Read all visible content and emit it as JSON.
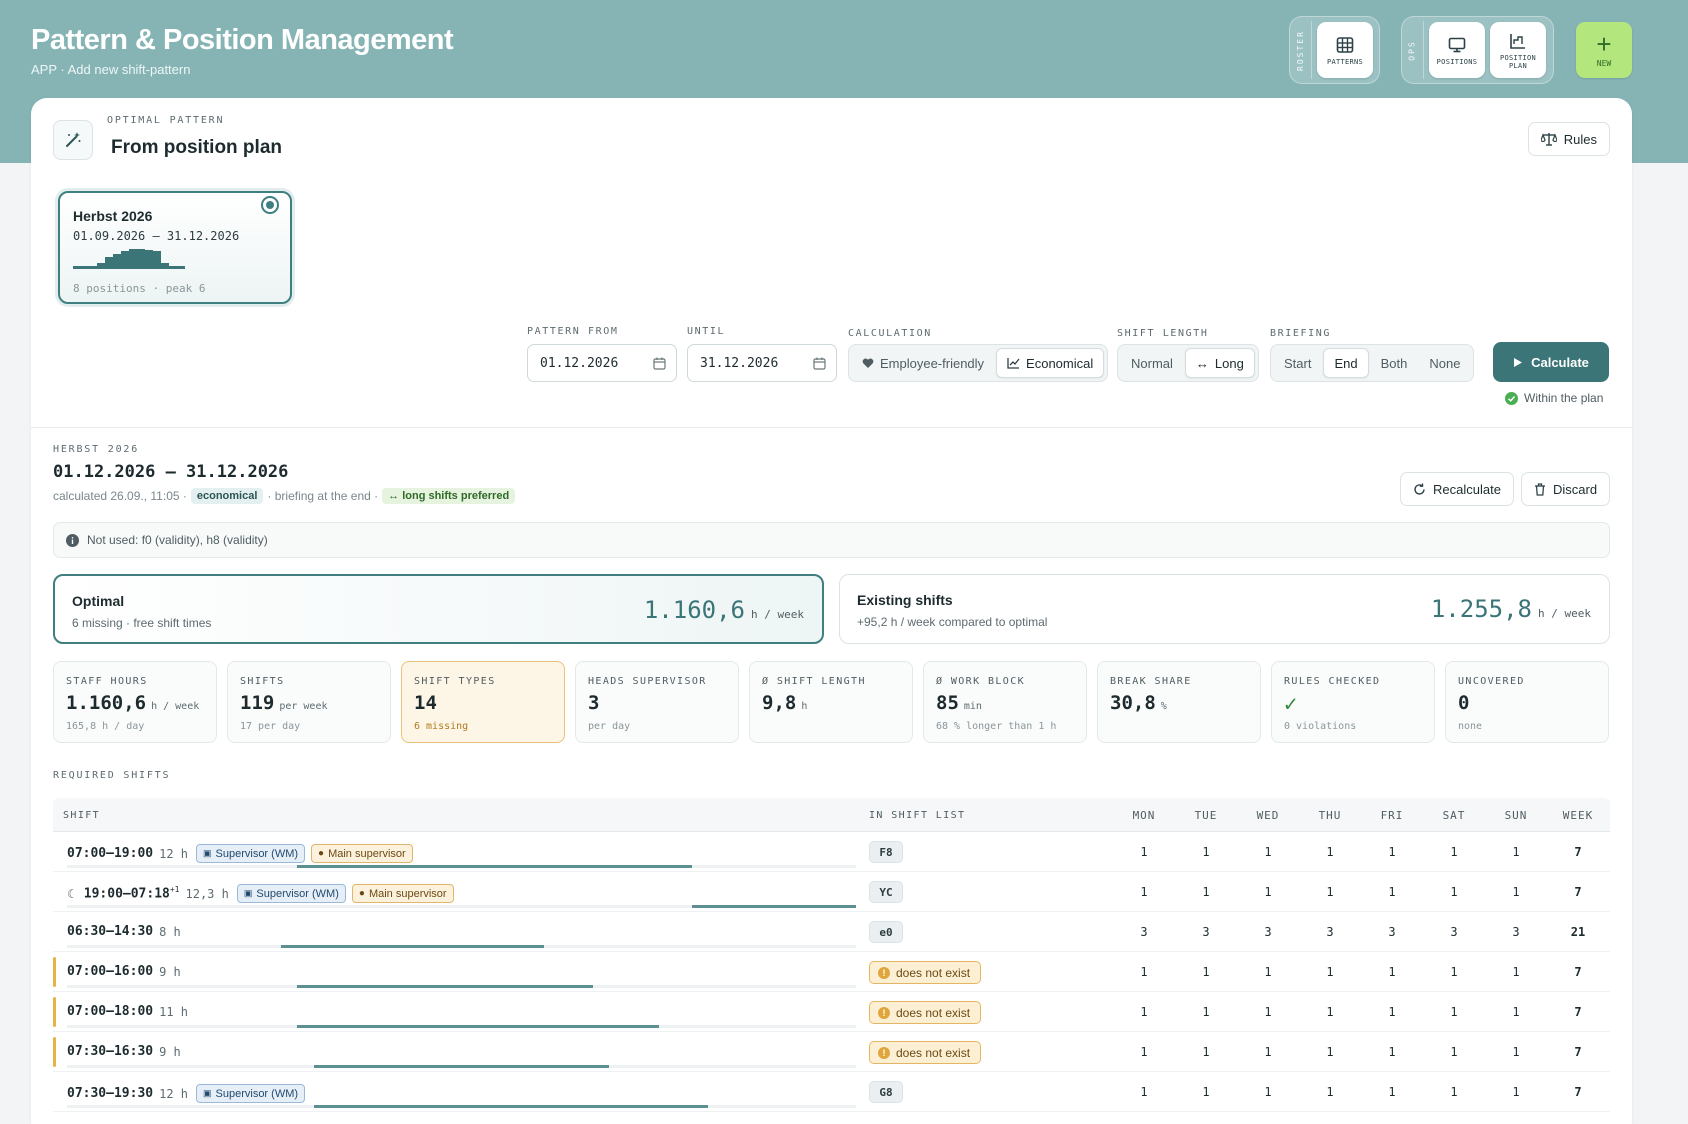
{
  "app": {
    "title": "Pattern & Position Management",
    "breadcrumb": "APP · Add new shift-pattern"
  },
  "nav": {
    "roster_label": "ROSTER",
    "ops_label": "OPS",
    "patterns": "PATTERNS",
    "positions": "POSITIONS",
    "position_plan_1": "POSITION",
    "position_plan_2": "PLAN",
    "new": "NEW"
  },
  "header": {
    "kicker": "OPTIMAL PATTERN",
    "title": "From position plan",
    "rules": "Rules"
  },
  "plan": {
    "name": "Herbst 2026",
    "range": "01.09.2026 – 31.12.2026",
    "footer": "8 positions · peak 6",
    "profile": [
      0.15,
      0.15,
      0.15,
      0.3,
      0.6,
      0.75,
      0.9,
      1.0,
      1.0,
      0.95,
      0.9,
      0.3,
      0.15,
      0.15
    ]
  },
  "form": {
    "from_label": "PATTERN FROM",
    "from_value": "01.12.2026",
    "until_label": "UNTIL",
    "until_value": "31.12.2026",
    "calc_label": "CALCULATION",
    "calc_opt1": "Employee-friendly",
    "calc_opt2": "Economical",
    "len_label": "SHIFT LENGTH",
    "len_opt1": "Normal",
    "len_opt2": "Long",
    "brief_label": "BRIEFING",
    "brief_opt1": "Start",
    "brief_opt2": "End",
    "brief_opt3": "Both",
    "brief_opt4": "None",
    "calculate": "Calculate",
    "within": "Within the plan"
  },
  "result": {
    "kicker": "HERBST 2026",
    "range": "01.12.2026 – 31.12.2026",
    "calculated": "calculated 26.09., 11:05 ·",
    "mode": "economical",
    "briefing": "· briefing at the end ·",
    "pref": "↔ long shifts preferred",
    "recalculate": "Recalculate",
    "discard": "Discard",
    "info": "Not used: f0 (validity), h8 (validity)"
  },
  "compare": {
    "optimal": {
      "title": "Optimal",
      "sub": "6 missing · free shift times",
      "value": "1.160,6",
      "unit": "h / week"
    },
    "existing": {
      "title": "Existing shifts",
      "sub": "+95,2 h / week compared to optimal",
      "value": "1.255,8",
      "unit": "h / week"
    }
  },
  "kpis": [
    {
      "label": "STAFF HOURS",
      "value": "1.160,6",
      "unit": "h / week",
      "sub": "165,8 h / day"
    },
    {
      "label": "SHIFTS",
      "value": "119",
      "unit": "per week",
      "sub": "17 per day"
    },
    {
      "label": "SHIFT TYPES",
      "value": "14",
      "unit": "",
      "sub": "6 missing"
    },
    {
      "label": "HEADS SUPERVISOR",
      "value": "3",
      "unit": "",
      "sub": "per day"
    },
    {
      "label": "Ø SHIFT LENGTH",
      "value": "9,8",
      "unit": "h",
      "sub": ""
    },
    {
      "label": "Ø WORK BLOCK",
      "value": "85",
      "unit": "min",
      "sub": "68 % longer than 1 h"
    },
    {
      "label": "BREAK SHARE",
      "value": "30,8",
      "unit": "%",
      "sub": ""
    },
    {
      "label": "RULES CHECKED",
      "value": "✓",
      "unit": "",
      "sub": "0 violations"
    },
    {
      "label": "UNCOVERED",
      "value": "0",
      "unit": "",
      "sub": "none"
    }
  ],
  "table": {
    "kicker": "REQUIRED SHIFTS",
    "col_shift": "SHIFT",
    "col_list": "IN SHIFT LIST",
    "days": [
      "MON",
      "TUE",
      "WED",
      "THU",
      "FRI",
      "SAT",
      "SUN",
      "WEEK"
    ],
    "missing_label": "does not exist",
    "tag_supervisor": "Supervisor (WM)",
    "tag_main": "Main supervisor",
    "rows": [
      {
        "time": "07:00–19:00",
        "len": "12 h",
        "code": "F8",
        "counts": [
          "1",
          "1",
          "1",
          "1",
          "1",
          "1",
          "1",
          "7"
        ],
        "start": 7,
        "end": 19
      },
      {
        "time": "19:00–07:18",
        "sup": "+1",
        "len": "12,3 h",
        "code": "YC",
        "counts": [
          "1",
          "1",
          "1",
          "1",
          "1",
          "1",
          "1",
          "7"
        ],
        "start": 19,
        "end": 24
      },
      {
        "time": "06:30–14:30",
        "len": "8 h",
        "code": "e0",
        "counts": [
          "3",
          "3",
          "3",
          "3",
          "3",
          "3",
          "3",
          "21"
        ],
        "start": 6.5,
        "end": 14.5
      },
      {
        "time": "07:00–16:00",
        "len": "9 h",
        "code": "",
        "counts": [
          "1",
          "1",
          "1",
          "1",
          "1",
          "1",
          "1",
          "7"
        ],
        "start": 7,
        "end": 16
      },
      {
        "time": "07:00–18:00",
        "len": "11 h",
        "code": "",
        "counts": [
          "1",
          "1",
          "1",
          "1",
          "1",
          "1",
          "1",
          "7"
        ],
        "start": 7,
        "end": 18
      },
      {
        "time": "07:30–16:30",
        "len": "9 h",
        "code": "",
        "counts": [
          "1",
          "1",
          "1",
          "1",
          "1",
          "1",
          "1",
          "7"
        ],
        "start": 7.5,
        "end": 16.5
      },
      {
        "time": "07:30–19:30",
        "len": "12 h",
        "code": "G8",
        "counts": [
          "1",
          "1",
          "1",
          "1",
          "1",
          "1",
          "1",
          "7"
        ],
        "start": 7.5,
        "end": 19.5
      }
    ]
  }
}
